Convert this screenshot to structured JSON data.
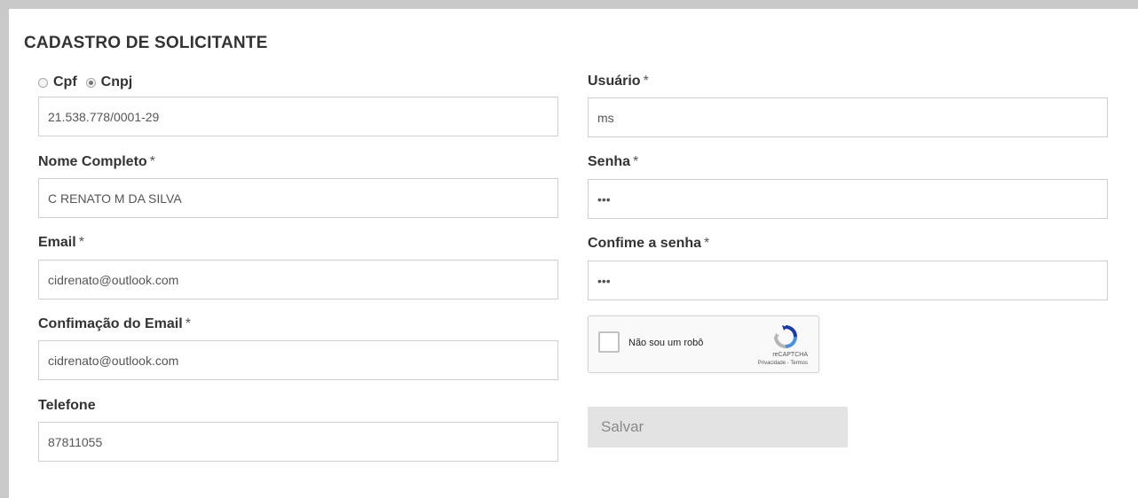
{
  "form": {
    "title": "CADASTRO DE SOLICITANTE",
    "required_marker": "*",
    "doc_type": {
      "options": [
        "Cpf",
        "Cnpj"
      ],
      "selected": "Cnpj",
      "value": "21.538.778/0001-29"
    },
    "nome": {
      "label": "Nome Completo",
      "value": "C RENATO M DA SILVA"
    },
    "email": {
      "label": "Email",
      "value": "cidrenato@outlook.com"
    },
    "email_confirm": {
      "label": "Confimação do Email",
      "value": "cidrenato@outlook.com"
    },
    "telefone": {
      "label": "Telefone",
      "value": "87811055"
    },
    "usuario": {
      "label": "Usuário",
      "value": "ms"
    },
    "senha": {
      "label": "Senha",
      "value": "•••"
    },
    "senha_confirm": {
      "label": "Confime a senha",
      "value": "•••"
    },
    "captcha": {
      "label": "Não sou um robô",
      "brand": "reCAPTCHA",
      "privacy": "Privacidade",
      "separator": " - ",
      "terms": "Termos"
    },
    "save_label": "Salvar"
  }
}
